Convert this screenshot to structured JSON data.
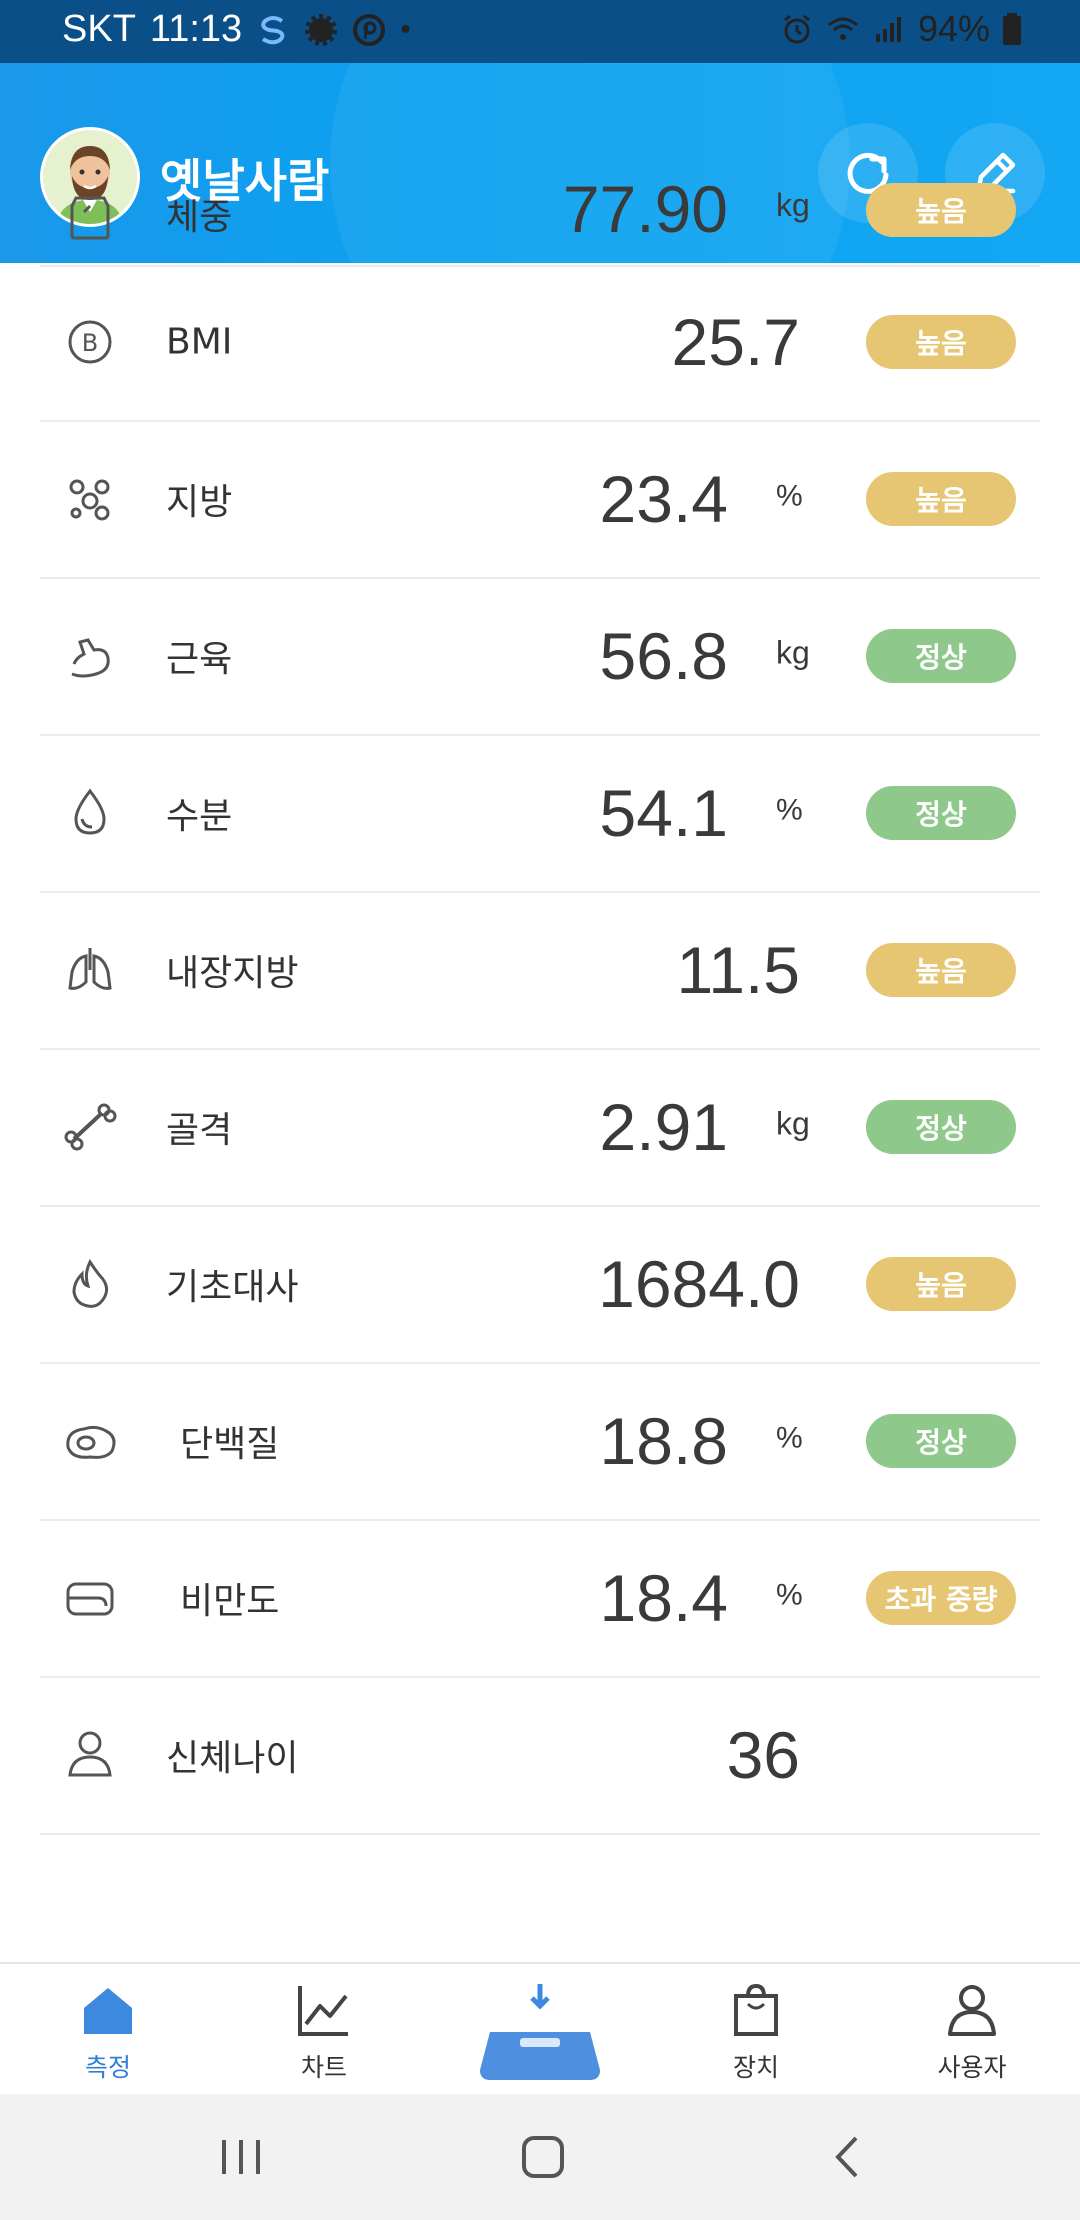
{
  "status_bar": {
    "carrier": "SKT",
    "time": "11:13",
    "battery": "94%"
  },
  "header": {
    "user_name": "옛날사람"
  },
  "metrics": [
    {
      "label": "체중",
      "value": "77.90",
      "unit": "kg",
      "badge": "높음",
      "badge_color": "#e6c673",
      "icon": "scale-icon"
    },
    {
      "label": "BMI",
      "value": "25.7",
      "unit": "",
      "badge": "높음",
      "badge_color": "#e6c673",
      "icon": "bmi-icon"
    },
    {
      "label": "지방",
      "value": "23.4",
      "unit": "%",
      "badge": "높음",
      "badge_color": "#e6c673",
      "icon": "fat-icon"
    },
    {
      "label": "근육",
      "value": "56.8",
      "unit": "kg",
      "badge": "정상",
      "badge_color": "#8ec98b",
      "icon": "muscle-icon"
    },
    {
      "label": "수분",
      "value": "54.1",
      "unit": "%",
      "badge": "정상",
      "badge_color": "#8ec98b",
      "icon": "water-drop-icon"
    },
    {
      "label": "내장지방",
      "value": "11.5",
      "unit": "",
      "badge": "높음",
      "badge_color": "#e6c673",
      "icon": "lungs-icon"
    },
    {
      "label": "골격",
      "value": "2.91",
      "unit": "kg",
      "badge": "정상",
      "badge_color": "#8ec98b",
      "icon": "bone-icon"
    },
    {
      "label": "기초대사",
      "value": "1684.0",
      "unit": "",
      "badge": "높음",
      "badge_color": "#e6c673",
      "icon": "flame-icon"
    },
    {
      "label": "단백질",
      "value": "18.8",
      "unit": "%",
      "badge": "정상",
      "badge_color": "#8ec98b",
      "icon": "egg-icon"
    },
    {
      "label": "비만도",
      "value": "18.4",
      "unit": "%",
      "badge": "초과 중량",
      "badge_color": "#e6c673",
      "icon": "belly-icon"
    },
    {
      "label": "신체나이",
      "value": "36",
      "unit": "",
      "badge": "",
      "badge_color": "",
      "icon": "body-age-icon"
    }
  ],
  "bottom_nav": {
    "measure": "측정",
    "chart": "차트",
    "device": "장치",
    "user": "사용자"
  },
  "colors": {
    "accent": "#2f7fd6",
    "header": "#0aa1f0",
    "badge_high": "#e6c673",
    "badge_normal": "#8ec98b"
  }
}
